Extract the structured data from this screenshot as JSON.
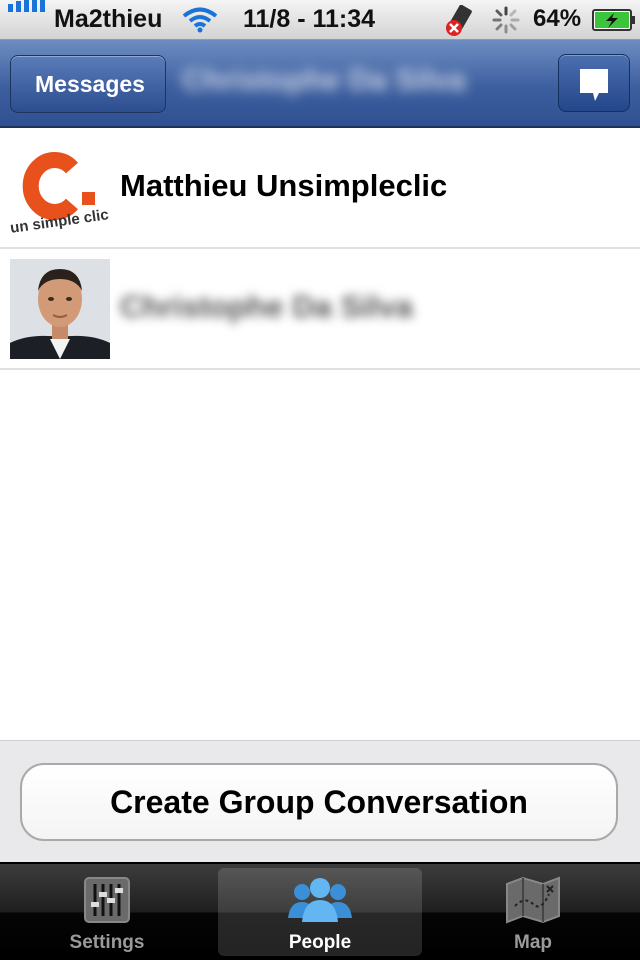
{
  "status": {
    "carrier": "Ma2thieu",
    "time": "11/8 - 11:34",
    "battery": "64%"
  },
  "nav": {
    "back_label": "Messages",
    "title": "Christophe Da Silva"
  },
  "contacts": [
    {
      "name": "Matthieu Unsimpleclic",
      "avatar_text": "un simple clic"
    },
    {
      "name": "Christophe Da Silva"
    }
  ],
  "actions": {
    "group_button": "Create Group Conversation"
  },
  "tabs": [
    {
      "label": "Settings",
      "icon": "sliders-icon"
    },
    {
      "label": "People",
      "icon": "people-icon",
      "active": true
    },
    {
      "label": "Map",
      "icon": "map-icon"
    }
  ],
  "colors": {
    "nav": "#3d5f9f",
    "tab_active": "#4aa3e8",
    "brand_orange": "#e8501c"
  }
}
